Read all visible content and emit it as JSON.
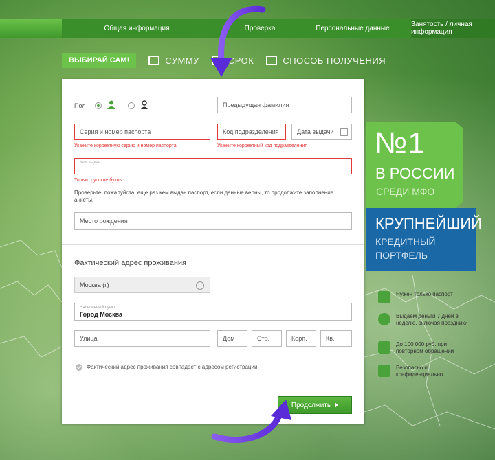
{
  "steps": [
    {
      "label": "Общая информация"
    },
    {
      "label": "Проверка"
    },
    {
      "label": "Персональные данные"
    },
    {
      "label": "Занятость / личная информация"
    }
  ],
  "subnav": {
    "badge": "ВЫБИРАЙ САМ!",
    "items": [
      "СУММУ",
      "СРОК",
      "СПОСОБ ПОЛУЧЕНИЯ"
    ]
  },
  "form": {
    "gender_label": "Пол",
    "prev_surname_placeholder": "Предыдущая фамилия",
    "passport_placeholder": "Серия и номер паспорта",
    "passport_error": "Укажите корректную серию и номер паспорта",
    "division_code_placeholder": "Код подразделения",
    "division_code_error": "Укажите корректный код подразделения",
    "issue_date_placeholder": "Дата выдачи",
    "issued_by_placeholder": "Кем выдан",
    "issued_by_error": "Только русские буквы",
    "hint": "Проверьте, пожалуйста, еще раз кем выдан паспорт, если данные верны, то продолжите заполнение анкеты.",
    "birthplace_placeholder": "Место рождения",
    "address_title": "Фактический адрес проживания",
    "region_value": "Москва (г)",
    "city_label": "Населенный пункт",
    "city_value": "Город Москва",
    "street_placeholder": "Улица",
    "house_placeholder": "Дом",
    "building_placeholder": "Стр.",
    "corpus_placeholder": "Корп.",
    "apartment_placeholder": "Кв.",
    "same_address_label": "Фактический адрес проживания совпадает с адресом регистрации",
    "continue_label": "Продолжить"
  },
  "promo": {
    "no1": "№1",
    "russia": "В РОССИИ",
    "mfo": "СРЕДИ МФО",
    "biggest": "КРУПНЕЙШИЙ",
    "credit": "КРЕДИТНЫЙ",
    "portfolio": "ПОРТФЕЛЬ"
  },
  "features": [
    {
      "text": "Нужен только паспорт",
      "icon": "passport-icon"
    },
    {
      "text": "Выдаем деньги 7 дней в неделю, включая праздники",
      "icon": "24h-icon"
    },
    {
      "text": "До 100 000 руб. при повторном обращении",
      "icon": "wallet-icon"
    },
    {
      "text": "Безопасно и конфиденциально",
      "icon": "lock-icon"
    }
  ],
  "colors": {
    "accent_green": "#6cc24a",
    "promo_blue": "#1a68a6",
    "error_red": "#e23b3b",
    "annotation_purple": "#6a3be0"
  }
}
